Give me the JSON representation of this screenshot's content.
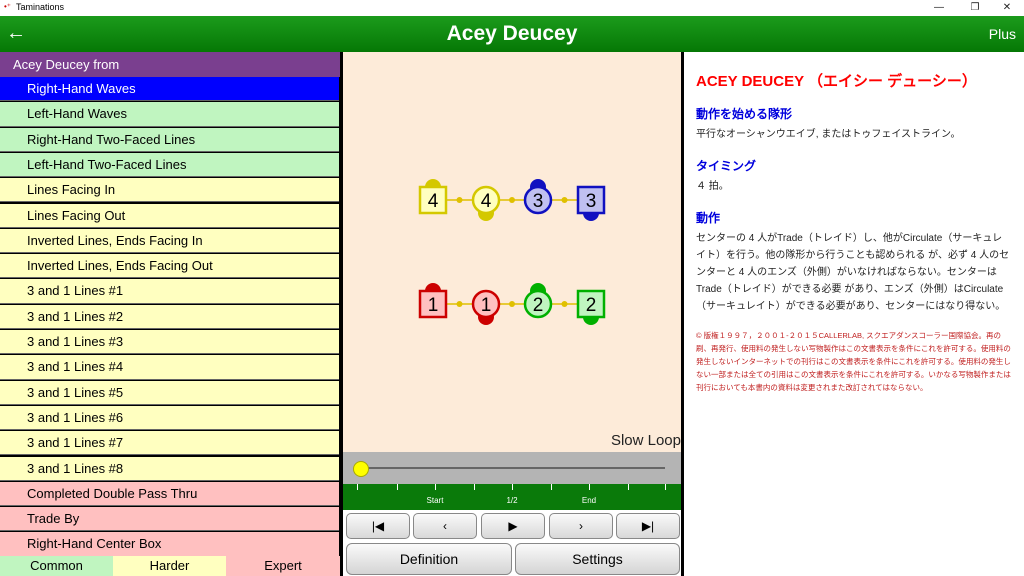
{
  "window": {
    "title": "Taminations",
    "icon": "•⁺"
  },
  "header": {
    "back": "←",
    "title": "Acey Deucey",
    "plus": "Plus"
  },
  "list": {
    "header": "Acey Deucey from",
    "items": [
      {
        "label": "Right-Hand Waves",
        "style": "sel"
      },
      {
        "label": "Left-Hand Waves",
        "style": "green"
      },
      {
        "label": "Right-Hand Two-Faced Lines",
        "style": "green"
      },
      {
        "label": "Left-Hand Two-Faced Lines",
        "style": "green"
      },
      {
        "label": "Lines Facing In",
        "style": "yellow"
      },
      {
        "label": "Lines Facing Out",
        "style": "yellow"
      },
      {
        "label": "Inverted Lines, Ends Facing In",
        "style": "yellow"
      },
      {
        "label": "Inverted Lines, Ends Facing Out",
        "style": "yellow"
      },
      {
        "label": "3 and 1 Lines #1",
        "style": "yellow"
      },
      {
        "label": "3 and 1 Lines #2",
        "style": "yellow"
      },
      {
        "label": "3 and 1 Lines #3",
        "style": "yellow"
      },
      {
        "label": "3 and 1 Lines #4",
        "style": "yellow"
      },
      {
        "label": "3 and 1 Lines #5",
        "style": "yellow"
      },
      {
        "label": "3 and 1 Lines #6",
        "style": "yellow"
      },
      {
        "label": "3 and 1 Lines #7",
        "style": "yellow"
      },
      {
        "label": "3 and 1 Lines #8",
        "style": "yellow"
      },
      {
        "label": "Completed Double Pass Thru",
        "style": "pink"
      },
      {
        "label": "Trade By",
        "style": "pink"
      },
      {
        "label": "Right-Hand Center Box",
        "style": "pink"
      }
    ],
    "levels": [
      {
        "label": "Common",
        "color": "#c0f5c0"
      },
      {
        "label": "Harder",
        "color": "#ffffc0"
      },
      {
        "label": "Expert",
        "color": "#ffc0c0"
      }
    ]
  },
  "animation": {
    "dancers": [
      {
        "num": "4",
        "shape": "square",
        "color": "#d4c800",
        "fill": "#ffffc0",
        "facing": "up"
      },
      {
        "num": "4",
        "shape": "circle",
        "color": "#d4c800",
        "fill": "#ffffc0",
        "facing": "down"
      },
      {
        "num": "3",
        "shape": "circle",
        "color": "#1010c0",
        "fill": "#c0c0f0",
        "facing": "up"
      },
      {
        "num": "3",
        "shape": "square",
        "color": "#1010c0",
        "fill": "#c0c0f0",
        "facing": "down"
      },
      {
        "num": "1",
        "shape": "square",
        "color": "#cc0000",
        "fill": "#ffc0c0",
        "facing": "up"
      },
      {
        "num": "1",
        "shape": "circle",
        "color": "#cc0000",
        "fill": "#ffc0c0",
        "facing": "down"
      },
      {
        "num": "2",
        "shape": "circle",
        "color": "#00b000",
        "fill": "#c0f5c0",
        "facing": "up"
      },
      {
        "num": "2",
        "shape": "square",
        "color": "#00b000",
        "fill": "#c0f5c0",
        "facing": "down"
      }
    ],
    "slow_loop": "Slow Loop",
    "progress": 0,
    "ticks": {
      "start": "Start",
      "half": "1/2",
      "end": "End"
    },
    "buttons": {
      "first": "|◀",
      "prev": "‹",
      "play": "▶",
      "next": "›",
      "last": "▶|"
    },
    "definition": "Definition",
    "settings": "Settings"
  },
  "definition": {
    "title": "ACEY DEUCEY （エイシー デューシー）",
    "s1_head": "動作を始める隊形",
    "s1_text": "平行なオーシャンウエイブ, またはトゥフェイストライン。",
    "s2_head": "タイミング",
    "s2_text": "４ 拍。",
    "s3_head": "動作",
    "s3_text": "センターの 4 人がTrade（トレイド）し、他がCirculate（サーキュレイト）を行う。他の隊形から行うことも認められる が、必ず 4 人のセンターと 4 人のエンズ（外側）がいなければならない。センターはTrade（トレイド）ができる必要 があり、エンズ（外側）はCirculate（サーキュレイト）ができる必要があり、センターにはなり得ない。",
    "copyright": "© 版権１９９７，２００１-２０１５CALLERLAB, スクエアダンスコーラー国際協会。再の刷、再発行、使用料の発生しない写物製作はこの文書表示を条件にこれを許可する。使用料の発生しないインターネットでの刊行はこの文書表示を条件にこれを許可する。使用料の発生しない一部または全ての引用はこの文書表示を条件にこれを許可する。いかなる写物製作または刊行においても本書内の資料は変更されまた改訂されてはならない。"
  }
}
